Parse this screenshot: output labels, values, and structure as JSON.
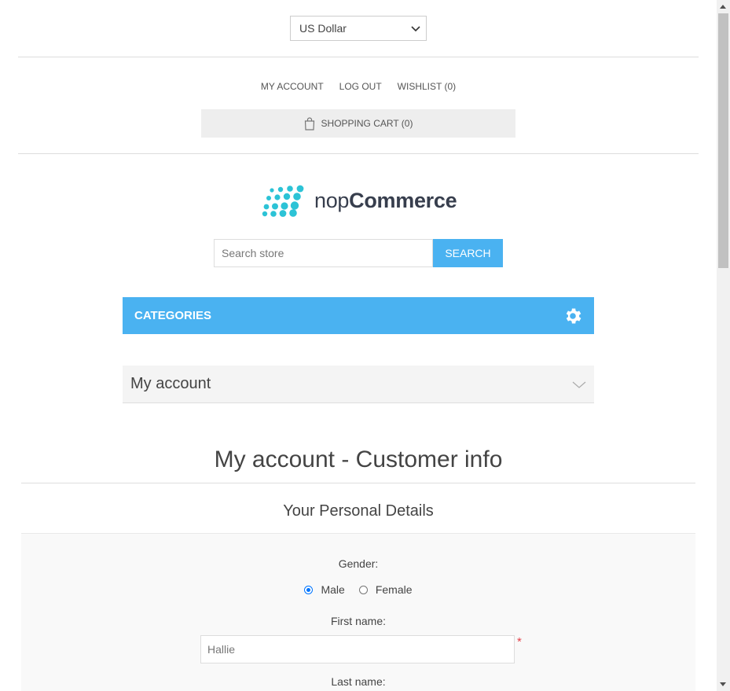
{
  "header": {
    "currency_selected": "US Dollar",
    "links": [
      "My account",
      "Log out",
      "Wishlist (0)"
    ],
    "cart_label": "Shopping cart (0)"
  },
  "logo": {
    "prefix": "nop",
    "suffix": "Commerce"
  },
  "search": {
    "placeholder": "Search store",
    "button_label": "Search"
  },
  "nav": {
    "categories_label": "Categories",
    "my_account_label": "My account"
  },
  "page": {
    "title": "My account - Customer info",
    "section_title": "Your Personal Details"
  },
  "form": {
    "gender_label": "Gender:",
    "gender_options": [
      "Male",
      "Female"
    ],
    "gender_selected": "Male",
    "first_name_label": "First name:",
    "first_name_value": "Hallie",
    "required_mark": "*",
    "last_name_label": "Last name:"
  },
  "colors": {
    "accent": "#4ab2f1",
    "logo_dots": "#2cc3d6",
    "required": "#e4434b"
  }
}
